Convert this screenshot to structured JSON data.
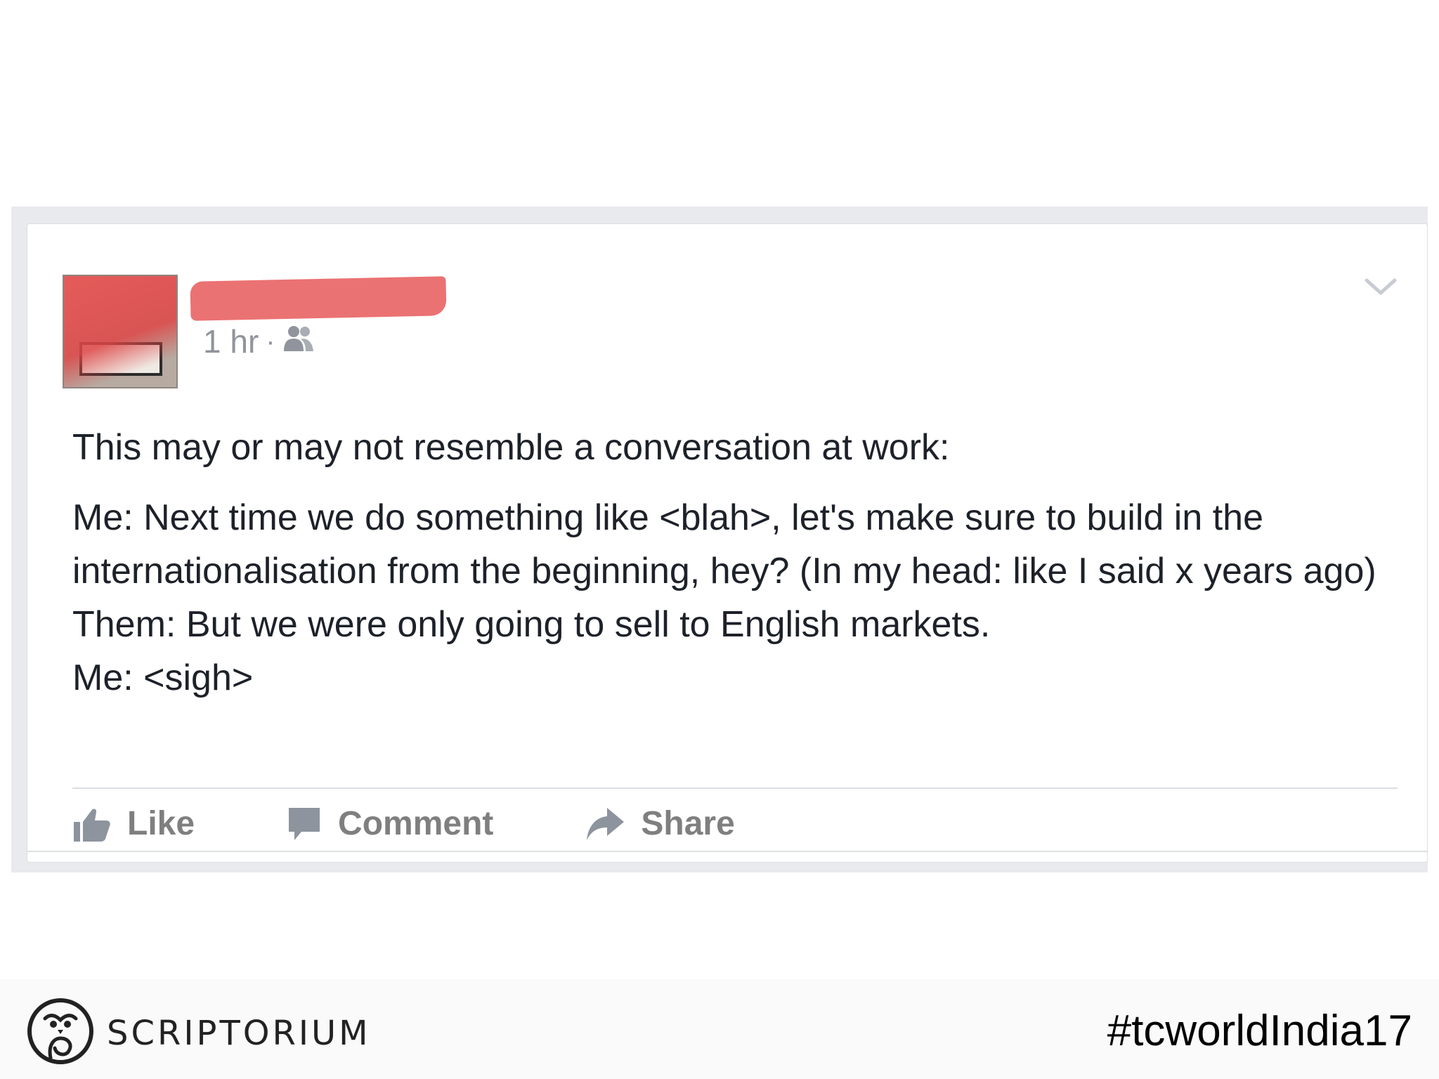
{
  "post": {
    "timestamp": "1 hr",
    "separator": "·",
    "audience_icon": "friends-icon",
    "menu_icon": "chevron-down-icon",
    "text": {
      "intro": "This may or may not resemble a conversation at work:",
      "line1": "Me: Next time we do something like <blah>, let's make sure to build in the internationalisation from the beginning, hey? (In my head: like I said x years ago)",
      "line2": "Them: But we were only going to sell to English markets.",
      "line3": "Me: <sigh>"
    },
    "actions": [
      {
        "label": "Like",
        "icon": "thumbs-up-icon"
      },
      {
        "label": "Comment",
        "icon": "comment-bubble-icon"
      },
      {
        "label": "Share",
        "icon": "share-arrow-icon"
      }
    ],
    "redaction_color": "#ea6a6a"
  },
  "footer": {
    "brand": "SCRIPTORIUM",
    "hashtag": "#tcworldIndia17",
    "logo_icon": "owl-logo-icon"
  }
}
